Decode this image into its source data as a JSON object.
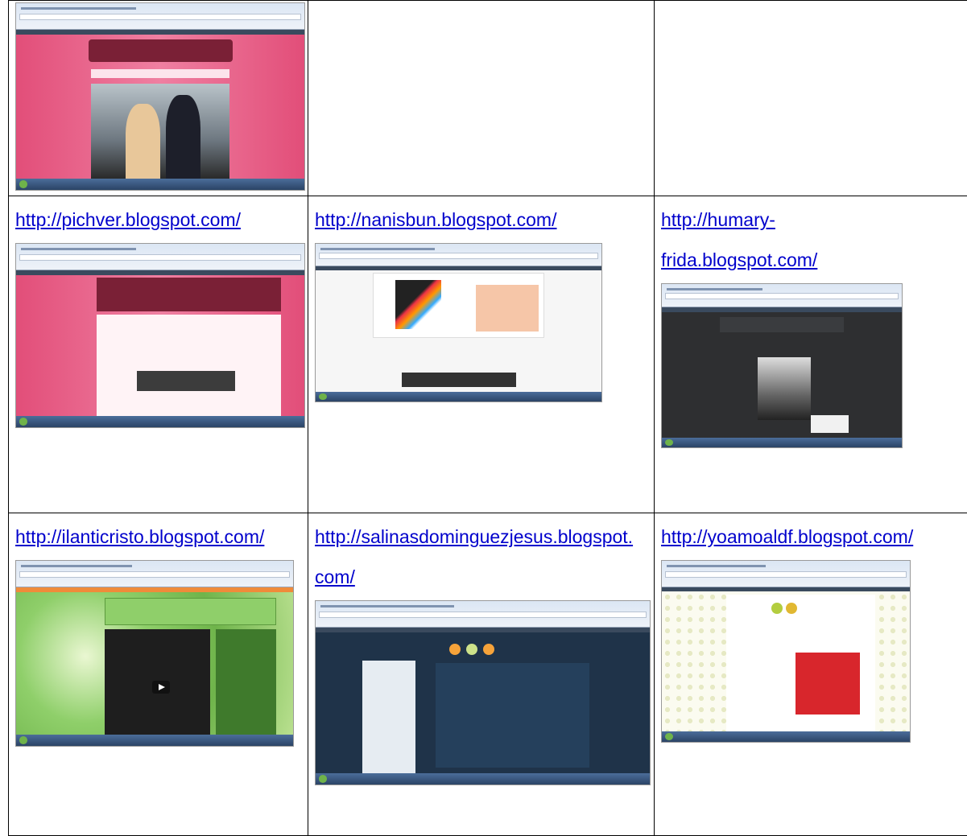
{
  "links": {
    "pichver": "http://pichver.blogspot.com/",
    "nanisbun": "http://nanisbun.blogspot.com/",
    "humary": "http://humary-frida.blogspot.com/",
    "ilanticristo": "http://ilanticristo.blogspot.com/",
    "salinas": "http://salinasdominguezjesus.blogspot.com/",
    "yoamoaldf": "http://yoamoaldf.blogspot.com/"
  },
  "colors": {
    "link": "#0000cc",
    "border": "#000000",
    "pink": "#e8547e",
    "dark_red": "#7a2036",
    "green": "#8fcf6a",
    "navy": "#1f3349",
    "orange": "#f08b3a",
    "red_poster": "#d8262c"
  }
}
